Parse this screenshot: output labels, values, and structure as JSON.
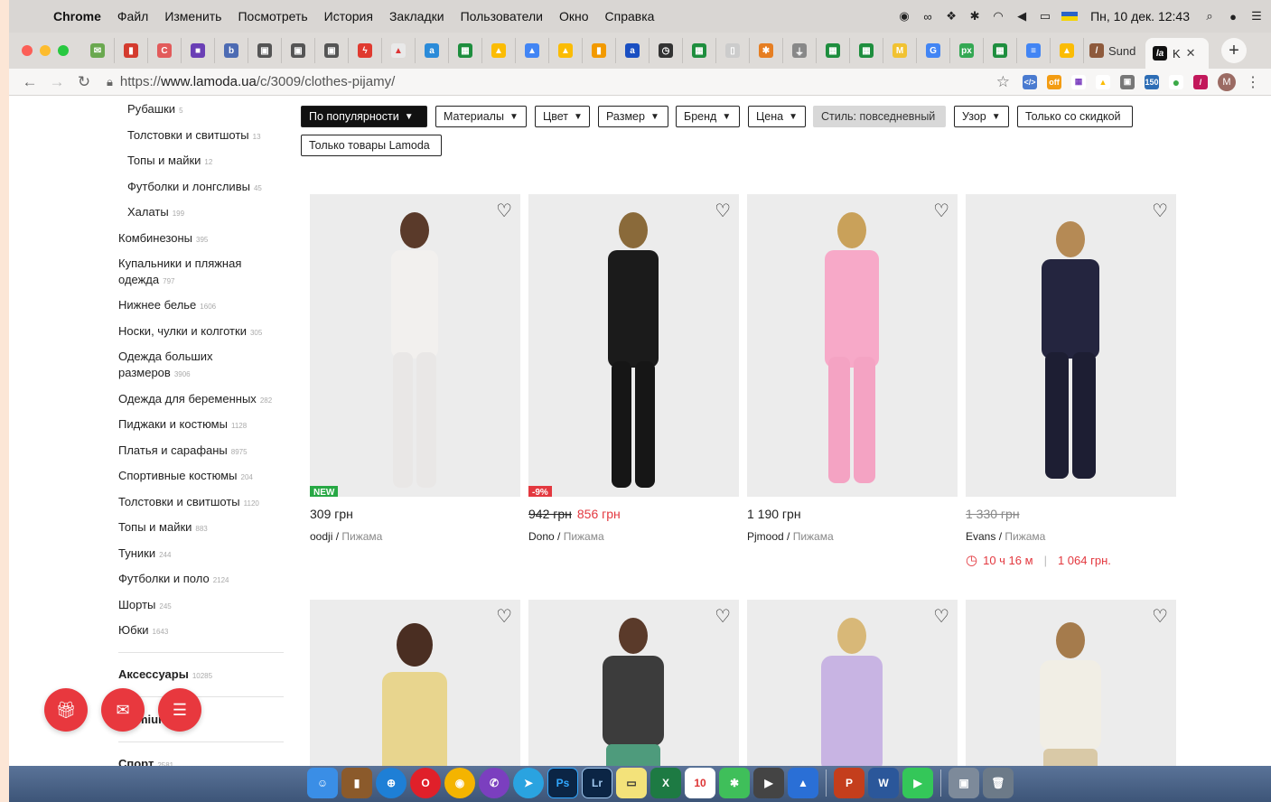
{
  "menubar": {
    "app": "Chrome",
    "items": [
      "Файл",
      "Изменить",
      "Посмотреть",
      "История",
      "Закладки",
      "Пользователи",
      "Окно",
      "Справка"
    ],
    "clock": "Пн, 10 дек.  12:43"
  },
  "tabs": {
    "inactive_tab_label": "Sund",
    "active_tab_label": "K",
    "active_tab_icon": "la",
    "new_tab": "+"
  },
  "address": {
    "scheme": "https://",
    "host": "www.lamoda.ua",
    "path": "/c/3009/clothes-pijamy/",
    "profile": "M"
  },
  "sidebar": {
    "items": [
      {
        "label": "Рубашки",
        "count": "5"
      },
      {
        "label": "Толстовки и свитшоты",
        "count": "13"
      },
      {
        "label": "Топы и майки",
        "count": "12"
      },
      {
        "label": "Футболки и лонгсливы",
        "count": "45"
      },
      {
        "label": "Халаты",
        "count": "199"
      },
      {
        "label": "Комбинезоны",
        "count": "395"
      },
      {
        "label": "Купальники и пляжная одежда",
        "count": "797"
      },
      {
        "label": "Нижнее белье",
        "count": "1606"
      },
      {
        "label": "Носки, чулки и колготки",
        "count": "305"
      },
      {
        "label": "Одежда больших размеров",
        "count": "3906"
      },
      {
        "label": "Одежда для беременных",
        "count": "282"
      },
      {
        "label": "Пиджаки и костюмы",
        "count": "1128"
      },
      {
        "label": "Платья и сарафаны",
        "count": "8975"
      },
      {
        "label": "Спортивные костюмы",
        "count": "204"
      },
      {
        "label": "Толстовки и свитшоты",
        "count": "1120"
      },
      {
        "label": "Топы и майки",
        "count": "883"
      },
      {
        "label": "Туники",
        "count": "244"
      },
      {
        "label": "Футболки и поло",
        "count": "2124"
      },
      {
        "label": "Шорты",
        "count": "245"
      },
      {
        "label": "Юбки",
        "count": "1643"
      }
    ],
    "accessories": {
      "label": "Аксессуары",
      "count": "10285"
    },
    "premium": {
      "label": "Premium",
      "partial": "miu"
    },
    "sport": {
      "label": "Спорт",
      "count": "2581"
    }
  },
  "filters": {
    "sort": "По популярности",
    "materials": "Материалы",
    "color": "Цвет",
    "size": "Размер",
    "brand": "Бренд",
    "price": "Цена",
    "style": "Стиль: повседневный",
    "pattern": "Узор",
    "discount_only": "Только со скидкой",
    "lamoda_only": "Только товары Lamoda"
  },
  "products": [
    {
      "badge": "NEW",
      "price": "309 грн",
      "brand": "oodji",
      "type": "Пижама",
      "badge_color": "#27a844",
      "shirt": "#f2f0ee",
      "pants": "#e9e7e6"
    },
    {
      "badge": "-9%",
      "old_price": "942 грн",
      "price": "856 грн",
      "brand": "Dono",
      "type": "Пижама",
      "badge_color": "#e3383f",
      "shirt": "#1b1b1b",
      "pants": "#161616"
    },
    {
      "price": "1 190 грн",
      "brand": "Pjmood",
      "type": "Пижама",
      "shirt": "#f7a9c8",
      "pants": "#f4a3c3"
    },
    {
      "old_price": "1 330 грн",
      "brand": "Evans",
      "type": "Пижама",
      "timer": "10 ч 16 м",
      "timer_price": "1 064 грн.",
      "shirt": "#24253f",
      "pants": "#1d1e33"
    },
    {
      "shirt": "#e8d58e",
      "pants": "#e8d58e"
    },
    {
      "shirt": "#3c3c3c",
      "pants": "#4e9b7c"
    },
    {
      "shirt": "#c8b4e3",
      "pants": "#ab93d6"
    },
    {
      "shirt": "#f1eee5",
      "pants": "#d9c9a7"
    }
  ],
  "colors": {
    "accent": "#e3383f",
    "fab": "#e8383e"
  }
}
